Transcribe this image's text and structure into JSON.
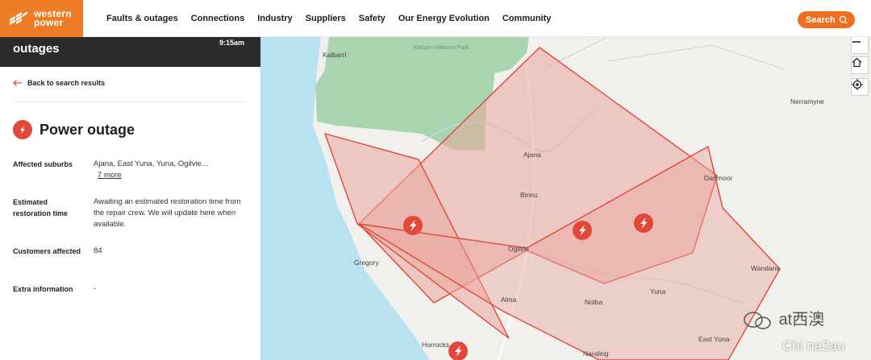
{
  "header": {
    "logo_line1": "western",
    "logo_line2": "power",
    "nav": [
      "Faults & outages",
      "Connections",
      "Industry",
      "Suppliers",
      "Safety",
      "Our Energy Evolution",
      "Community"
    ],
    "search_label": "Search"
  },
  "panel": {
    "head_title": "outages",
    "head_time": "9:15am",
    "back_label": "Back to search results",
    "title": "Power outage",
    "rows": [
      {
        "label": "Affected suburbs",
        "value": "Ajana, East Yuna, Yuna, Ogilvie...",
        "more": "7 more"
      },
      {
        "label": "Estimated restoration time",
        "value": "Awaiting an estimated restoration time from the repair crew. We will update here when available."
      },
      {
        "label": "Customers affected",
        "value": "84"
      },
      {
        "label": "Extra information",
        "value": "-"
      }
    ]
  },
  "map": {
    "places": [
      "Kalbarri",
      "Kalbarri National Park",
      "Nerramyne",
      "Ajana",
      "Binnu",
      "Dartmoor",
      "Ogilvie",
      "Gregory",
      "Yuna",
      "Nolba",
      "Wandana",
      "Alma",
      "Horrocks",
      "Naraling",
      "East Yuna"
    ],
    "controls": [
      "zoom-out",
      "home",
      "locate"
    ]
  },
  "watermark": {
    "line1": "at西澳",
    "line2": "Chi na2au"
  },
  "colors": {
    "brand_orange": "#ef7d28",
    "search_orange": "#ef6f1f",
    "outage_red": "#e2483a",
    "polygon_fill": "#e9a79e",
    "park_green": "#a9d4b0",
    "ocean": "#b9e2f0",
    "land": "#f1f0ed"
  }
}
